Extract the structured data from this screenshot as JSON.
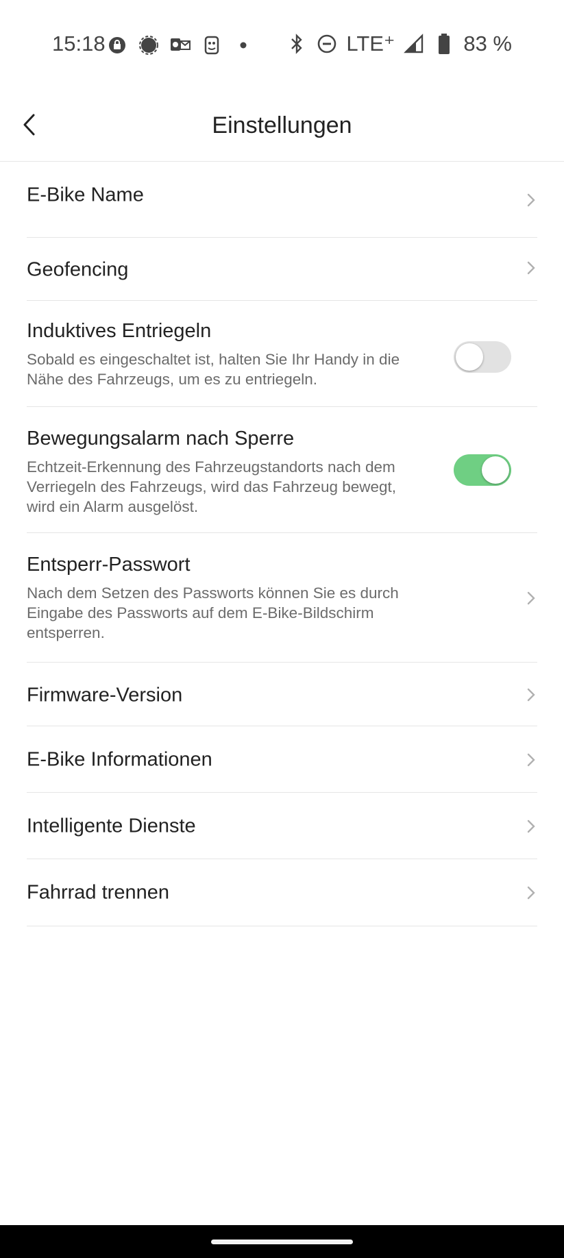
{
  "status_bar": {
    "time": "15:18",
    "network": "LTE⁺",
    "battery": "83 %"
  },
  "header": {
    "title": "Einstellungen"
  },
  "settings": [
    {
      "title": "E-Bike Name",
      "control": "chevron"
    },
    {
      "title": "Geofencing",
      "control": "chevron"
    },
    {
      "title": "Induktives Entriegeln",
      "description": "Sobald es eingeschaltet ist, halten Sie Ihr Handy in die Nähe des Fahrzeugs, um es zu entriegeln.",
      "control": "toggle",
      "enabled": false
    },
    {
      "title": "Bewegungsalarm nach Sperre",
      "description": "Echtzeit-Erkennung des Fahrzeugstandorts nach dem Verriegeln des Fahrzeugs, wird das Fahrzeug bewegt, wird ein Alarm ausgelöst.",
      "control": "toggle",
      "enabled": true
    },
    {
      "title": "Entsperr-Passwort",
      "description": "Nach dem Setzen des Passworts können Sie es durch Eingabe des Passworts auf dem E-Bike-Bildschirm entsperren.",
      "control": "chevron"
    },
    {
      "title": "Firmware-Version",
      "control": "chevron"
    },
    {
      "title": "E-Bike Informationen",
      "control": "chevron"
    },
    {
      "title": "Intelligente Dienste",
      "control": "chevron"
    },
    {
      "title": "Fahrrad trennen",
      "control": "chevron"
    }
  ],
  "colors": {
    "toggle_on": "#6fcf83",
    "toggle_off": "#e2e2e2",
    "chevron": "#b0b0b0"
  }
}
